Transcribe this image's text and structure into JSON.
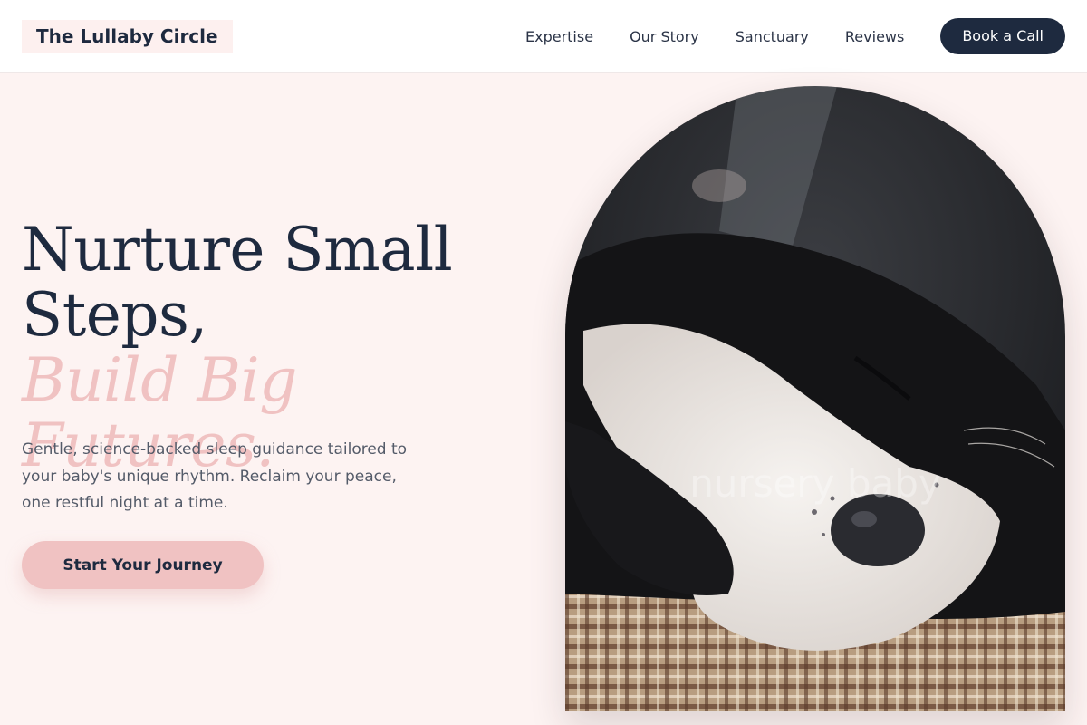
{
  "header": {
    "logo": "The Lullaby Circle",
    "nav": [
      "Expertise",
      "Our Story",
      "Sanctuary",
      "Reviews"
    ],
    "cta": "Book a Call"
  },
  "hero": {
    "title_line1": "Nurture Small Steps,",
    "title_accent": "Build Big Futures.",
    "subtitle": "Gentle, science-backed sleep guidance tailored to your baby's unique rhythm. Reclaim your peace, one restful night at a time.",
    "cta": "Start Your Journey",
    "image_alt": "nursery baby"
  },
  "colors": {
    "background": "#fdf3f2",
    "navy": "#1e2a3f",
    "blush": "#f0c2c2"
  }
}
